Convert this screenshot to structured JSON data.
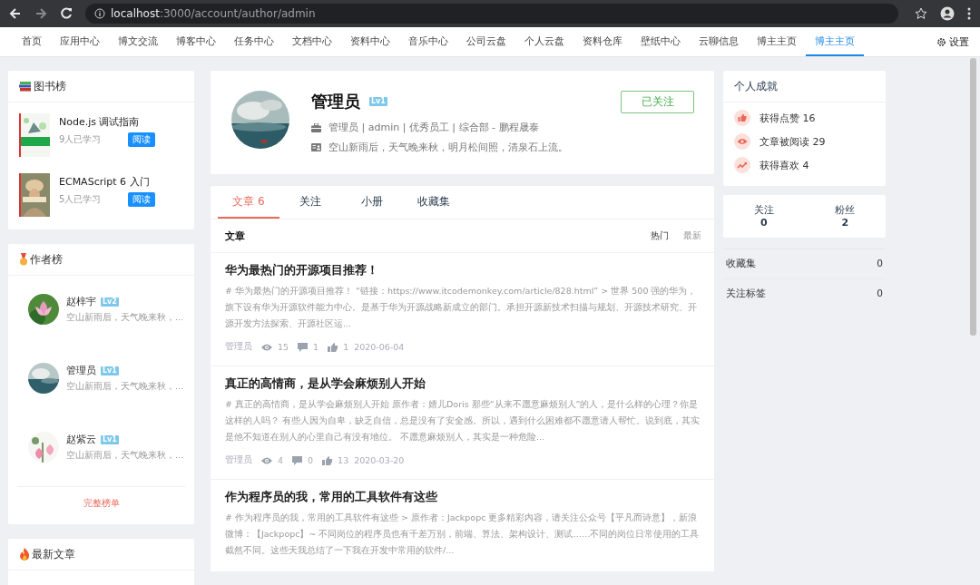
{
  "browser": {
    "url_host": "localhost",
    "url_path": ":3000/account/author/admin"
  },
  "nav": {
    "items": [
      {
        "label": "首页",
        "selected": false
      },
      {
        "label": "应用中心",
        "selected": false
      },
      {
        "label": "博文交流",
        "selected": false
      },
      {
        "label": "博客中心",
        "selected": false
      },
      {
        "label": "任务中心",
        "selected": false
      },
      {
        "label": "文档中心",
        "selected": false
      },
      {
        "label": "资料中心",
        "selected": false
      },
      {
        "label": "音乐中心",
        "selected": false
      },
      {
        "label": "公司云盘",
        "selected": false
      },
      {
        "label": "个人云盘",
        "selected": false
      },
      {
        "label": "资料仓库",
        "selected": false
      },
      {
        "label": "壁纸中心",
        "selected": false
      },
      {
        "label": "云聊信息",
        "selected": false
      },
      {
        "label": "博主主页",
        "selected": false
      },
      {
        "label": "博主主页",
        "selected": true
      }
    ],
    "settings": "设置"
  },
  "book_rank": {
    "title": "图书榜",
    "books": [
      {
        "title": "Node.js 调试指南",
        "learners": "9人已学习",
        "action": "阅读"
      },
      {
        "title": "ECMAScript 6 入门",
        "learners": "5人已学习",
        "action": "阅读"
      }
    ]
  },
  "author_rank": {
    "title": "作者榜",
    "authors": [
      {
        "name": "赵梓宇",
        "level": "Lv2",
        "bio": "空山新雨后，天气晚来秋，..."
      },
      {
        "name": "管理员",
        "level": "Lv1",
        "bio": "空山新雨后，天气晚来秋，..."
      },
      {
        "name": "赵紫云",
        "level": "Lv1",
        "bio": "空山新雨后，天气晚来秋，..."
      }
    ],
    "more": "完整榜单"
  },
  "latest": {
    "title": "最新文章"
  },
  "profile": {
    "name": "管理员",
    "level": "Lv1",
    "info": "管理员 | admin | 优秀员工 | 综合部 - 鹏程晟泰",
    "bio": "空山新雨后，天气晚来秋，明月松间照，清泉石上流。",
    "follow_button": "已关注"
  },
  "tabs": [
    {
      "label": "文章",
      "count": "6",
      "selected": true
    },
    {
      "label": "关注",
      "selected": false
    },
    {
      "label": "小册",
      "selected": false
    },
    {
      "label": "收藏集",
      "selected": false
    }
  ],
  "list_header": {
    "title": "文章",
    "sorts": [
      {
        "label": "热门",
        "selected": true
      },
      {
        "label": "最新",
        "selected": false
      }
    ]
  },
  "articles": [
    {
      "title": "华为最热门的开源项目推荐！",
      "excerpt": "# 华为最热门的开源项目推荐！ “链接：https://www.itcodemonkey.com/article/828.html” > 世界 500 强的华为，旗下设有华为开源软件能力中心。是基于华为开源战略新成立的部门。承担开源新技术扫描与规划、开源技术研究、开源开发方法探索、开源社区运...",
      "author": "管理员",
      "views": "15",
      "comments": "1",
      "likes": "1",
      "date": "2020-06-04"
    },
    {
      "title": "真正的高情商，是从学会麻烦别人开始",
      "excerpt": "# 真正的高情商，是从学会麻烦别人开始 原作者：婧儿Doris 那些“从来不愿意麻烦别人”的人，是什么样的心理？你是这样的人吗？ 有些人因为自卑，缺乏自信，总是没有了安全感。所以，遇到什么困难都不愿意请人帮忙。说到底，其实是他不知道在别人的心里自己有没有地位。 不愿意麻烦别人，其实是一种危险...",
      "author": "管理员",
      "views": "4",
      "comments": "0",
      "likes": "13",
      "date": "2020-03-20"
    },
    {
      "title": "作为程序员的我，常用的工具软件有这些",
      "excerpt": "# 作为程序员的我，常用的工具软件有这些 > 原作者：Jackpopc 更多精彩内容，请关注公众号【平凡而诗意】，新浪微博：【Jackpopc】~ 不同岗位的程序员也有千差万别，前端、算法、架构设计、测试……不同的岗位日常使用的工具截然不同。这些天我总结了一下我在开发中常用的软件/..."
    }
  ],
  "achievements": {
    "title": "个人成就",
    "items": [
      {
        "kind": "likes",
        "label": "获得点赞",
        "value": "16"
      },
      {
        "kind": "reads",
        "label": "文章被阅读",
        "value": "29"
      },
      {
        "kind": "favorites",
        "label": "获得喜欢",
        "value": "4"
      }
    ]
  },
  "follow_stats": [
    {
      "label": "关注",
      "value": "0"
    },
    {
      "label": "粉丝",
      "value": "2"
    }
  ],
  "counts": [
    {
      "label": "收藏集",
      "value": "0"
    },
    {
      "label": "关注标签",
      "value": "0"
    }
  ]
}
